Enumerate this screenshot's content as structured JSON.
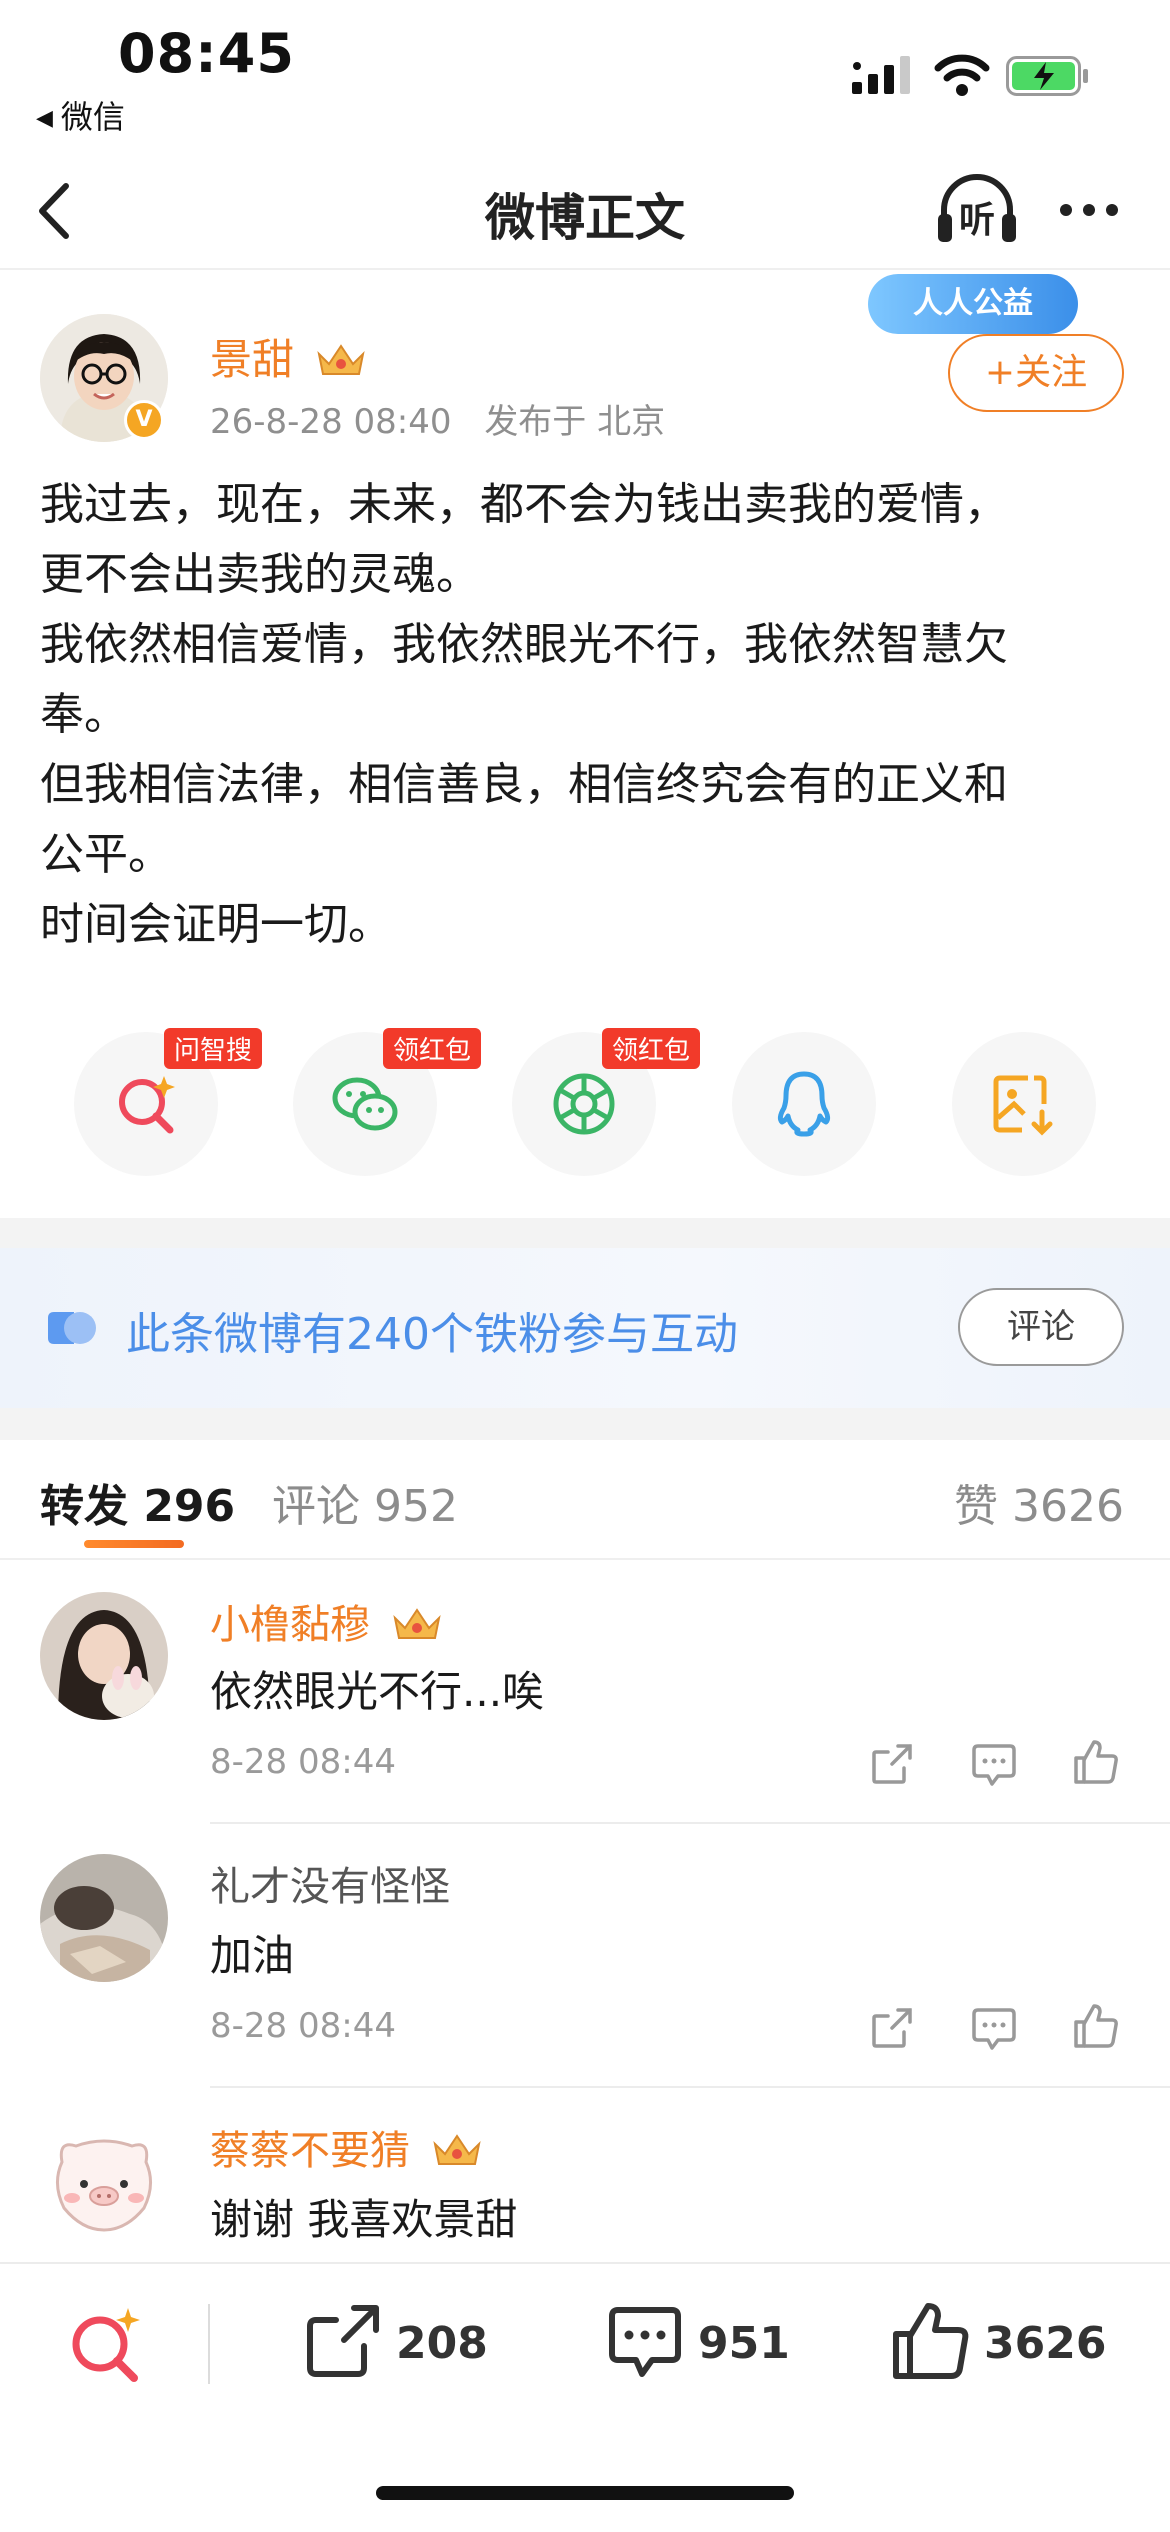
{
  "status_bar": {
    "time": "08:45",
    "back_app": "微信",
    "icons": [
      "cellular-signal-icon",
      "wifi-icon",
      "battery-charging-icon"
    ]
  },
  "nav": {
    "title": "微博正文",
    "listen_label": "听",
    "icons": [
      "back-chevron-icon",
      "headphone-icon",
      "more-dots-icon"
    ]
  },
  "post": {
    "author": "景甜",
    "date": "26-8-28 08:40",
    "location": "发布于 北京",
    "verified_badge": "V",
    "charity_label": "人人公益",
    "follow_label": "+关注",
    "lines": [
      "我过去，现在，未来，都不会为钱出卖我的爱情，",
      "更不会出卖我的灵魂。",
      "我依然相信爱情，我依然眼光不行，我依然智慧欠",
      "奉。",
      "但我相信法律，相信善良，相信终究会有的正义和",
      "公平。",
      "时间会证明一切。"
    ]
  },
  "share": {
    "items": [
      {
        "name": "ask-search",
        "icon": "q-search-icon",
        "tag": "问智搜"
      },
      {
        "name": "wechat",
        "icon": "wechat-icon",
        "tag": "领红包"
      },
      {
        "name": "moments",
        "icon": "moments-icon",
        "tag": "领红包"
      },
      {
        "name": "qq",
        "icon": "qq-icon",
        "tag": ""
      },
      {
        "name": "save-image",
        "icon": "save-image-icon",
        "tag": ""
      }
    ]
  },
  "fan_banner": {
    "text": "此条微博有240个铁粉参与互动",
    "button": "评论"
  },
  "tabs": {
    "repost": "转发 296",
    "comment": "评论 952",
    "like": "赞 3626"
  },
  "comments": [
    {
      "name": "小橹黏穆",
      "text": "依然眼光不行...唉",
      "time": "8-28 08:44",
      "gold": true
    },
    {
      "name": "礼才没有怪怪",
      "text": "加油",
      "time": "8-28 08:44",
      "gold": false
    },
    {
      "name": "蔡蔡不要猜",
      "text": "谢谢 我喜欢景甜",
      "time": "",
      "gold": true
    }
  ],
  "toolbar": {
    "repost_count": "208",
    "comment_count": "951",
    "like_count": "3626"
  },
  "colors": {
    "accent_orange": "#f07f26",
    "link_blue": "#4b8ee8",
    "badge_red": "#f23a2a"
  }
}
